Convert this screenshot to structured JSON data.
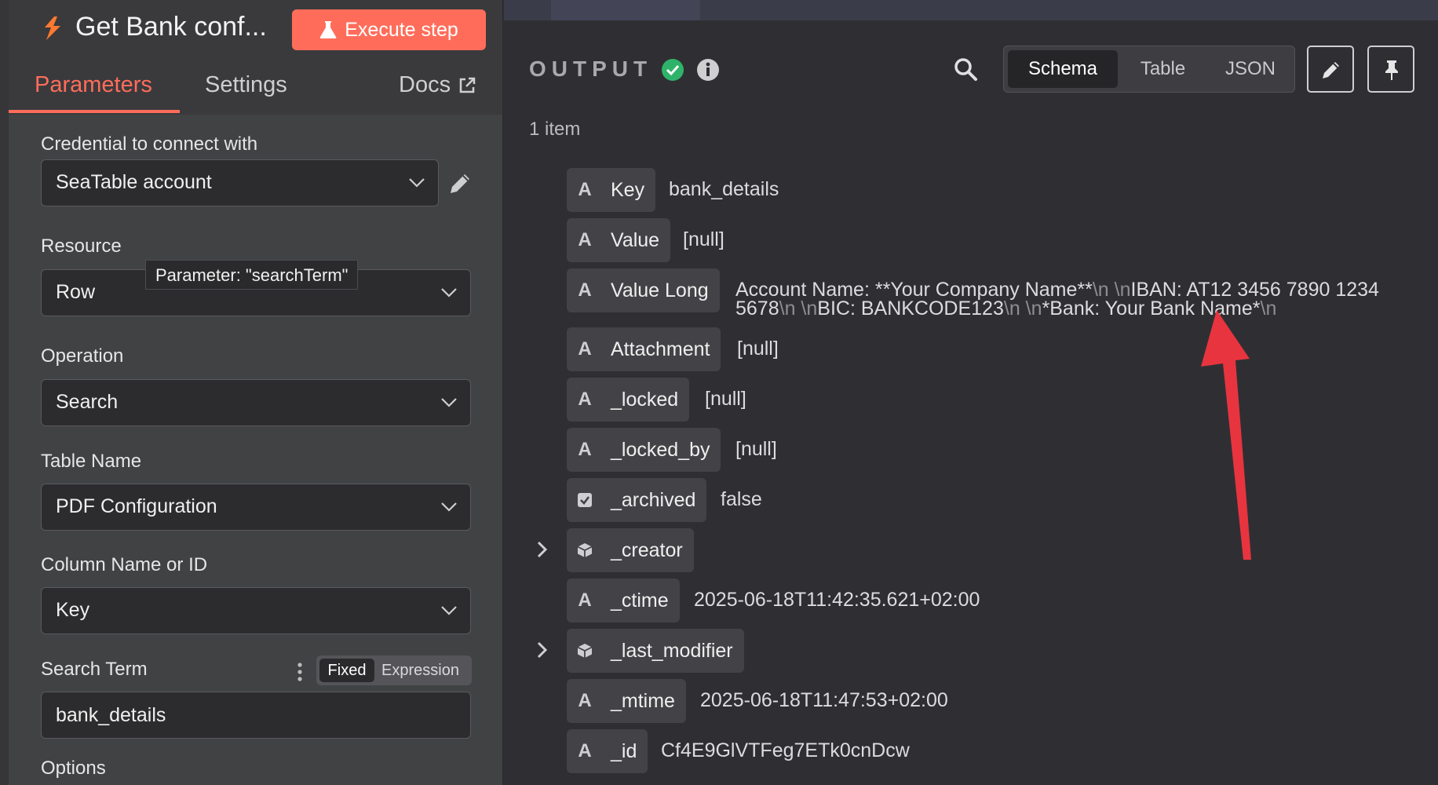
{
  "node": {
    "title": "Get Bank conf...",
    "execute_label": "Execute step",
    "tabs": {
      "parameters": "Parameters",
      "settings": "Settings",
      "docs": "Docs"
    }
  },
  "params": {
    "credential": {
      "label": "Credential to connect with",
      "value": "SeaTable account"
    },
    "resource": {
      "label": "Resource",
      "value": "Row",
      "tooltip": "Parameter: \"searchTerm\""
    },
    "operation": {
      "label": "Operation",
      "value": "Search"
    },
    "table_name": {
      "label": "Table Name",
      "value": "PDF Configuration"
    },
    "column": {
      "label": "Column Name or ID",
      "value": "Key"
    },
    "search_term": {
      "label": "Search Term",
      "fixed": "Fixed",
      "expression": "Expression",
      "value": "bank_details"
    },
    "options_label": "Options"
  },
  "output": {
    "title": "OUTPUT",
    "views": {
      "schema": "Schema",
      "table": "Table",
      "json": "JSON"
    },
    "item_count": "1 item",
    "fields": [
      {
        "key": "Key",
        "value": "bank_details",
        "type": "string"
      },
      {
        "key": "Value",
        "value": "[null]",
        "type": "string"
      },
      {
        "key": "Value Long",
        "value_lines": [
          [
            "Account Name: **Your Company Name**",
            "\\n \\n",
            "IBAN: AT12 3456 7890 1234"
          ],
          [
            "5678",
            "\\n \\n",
            "BIC: BANKCODE123",
            "\\n \\n",
            "*Bank: Your Bank Name*",
            "\\n"
          ]
        ],
        "type": "string"
      },
      {
        "key": "Attachment",
        "value": "[null]",
        "type": "string"
      },
      {
        "key": "_locked",
        "value": "[null]",
        "type": "string"
      },
      {
        "key": "_locked_by",
        "value": "[null]",
        "type": "string"
      },
      {
        "key": "_archived",
        "value": "false",
        "type": "boolean"
      },
      {
        "key": "_creator",
        "value": "",
        "type": "object"
      },
      {
        "key": "_ctime",
        "value": "2025-06-18T11:42:35.621+02:00",
        "type": "string"
      },
      {
        "key": "_last_modifier",
        "value": "",
        "type": "object"
      },
      {
        "key": "_mtime",
        "value": "2025-06-18T11:47:53+02:00",
        "type": "string"
      },
      {
        "key": "_id",
        "value": "Cf4E9GlVTFeg7ETk0cnDcw",
        "type": "string"
      }
    ]
  },
  "icons": {
    "node": "seatable-logo-icon",
    "execute": "flask-icon",
    "docs": "external-link-icon",
    "edit": "pencil-icon",
    "pin": "pin-icon",
    "status": "check-circle-icon",
    "info": "info-icon",
    "search": "search-icon",
    "string_type": "letter-a-icon",
    "boolean_type": "checkbox-icon",
    "object_type": "cube-icon"
  },
  "colors": {
    "accent": "#ff6d5a",
    "success": "#2fb36a",
    "annotation_arrow": "#e8343f",
    "panel_left": "#414244",
    "panel_right": "#2f2f33"
  }
}
